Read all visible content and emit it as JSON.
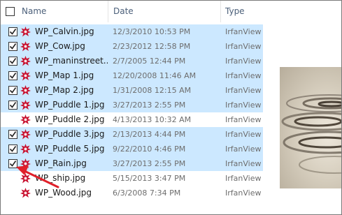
{
  "header": {
    "name_label": "Name",
    "date_label": "Date",
    "type_label": "Type"
  },
  "files": [
    {
      "name": "WP_Calvin.jpg",
      "date": "12/3/2010 10:53 PM",
      "type": "IrfanView",
      "selected": true,
      "checked": true
    },
    {
      "name": "WP_Cow.jpg",
      "date": "2/23/2012 12:58 PM",
      "type": "IrfanView",
      "selected": true,
      "checked": true
    },
    {
      "name": "WP_maninstreet....",
      "date": "2/7/2005 12:44 PM",
      "type": "IrfanView",
      "selected": true,
      "checked": true
    },
    {
      "name": "WP_Map 1.jpg",
      "date": "12/20/2008 11:46 AM",
      "type": "IrfanView",
      "selected": true,
      "checked": true
    },
    {
      "name": "WP_Map 2.jpg",
      "date": "1/31/2008 12:15 AM",
      "type": "IrfanView",
      "selected": true,
      "checked": true
    },
    {
      "name": "WP_Puddle 1.jpg",
      "date": "3/27/2013 2:55 PM",
      "type": "IrfanView",
      "selected": true,
      "checked": true
    },
    {
      "name": "WP_Puddle 2.jpg",
      "date": "4/13/2013 10:32 AM",
      "type": "IrfanView",
      "selected": false,
      "checked": false
    },
    {
      "name": "WP_Puddle 3.jpg",
      "date": "2/13/2013 4:44 PM",
      "type": "IrfanView",
      "selected": true,
      "checked": true
    },
    {
      "name": "WP_Puddle 5.jpg",
      "date": "9/22/2010 4:46 PM",
      "type": "IrfanView",
      "selected": true,
      "checked": true
    },
    {
      "name": "WP_Rain.jpg",
      "date": "3/27/2013 2:55 PM",
      "type": "IrfanView",
      "selected": true,
      "checked": true
    },
    {
      "name": "WP_ship.jpg",
      "date": "5/15/2013 3:47 PM",
      "type": "IrfanView",
      "selected": false,
      "checked": false
    },
    {
      "name": "WP_Wood.jpg",
      "date": "6/3/2008 7:34 PM",
      "type": "IrfanView",
      "selected": false,
      "checked": false
    }
  ],
  "colors": {
    "selection": "#cce8ff",
    "arrow": "#e0202a",
    "icon": "#c8102e"
  }
}
